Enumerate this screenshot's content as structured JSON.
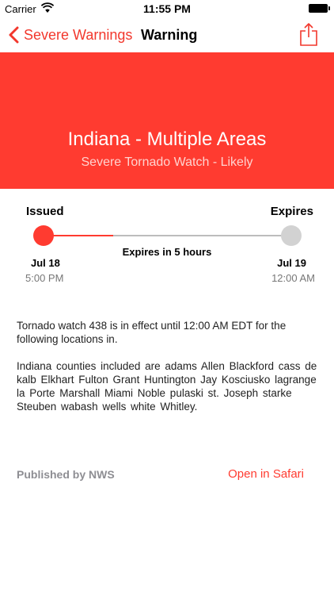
{
  "status_bar": {
    "carrier": "Carrier",
    "time": "11:55 PM"
  },
  "nav": {
    "back_label": "Severe Warnings",
    "title": "Warning"
  },
  "alert": {
    "title": "Indiana - Multiple Areas",
    "subtitle": "Severe Tornado Watch - Likely"
  },
  "timeline": {
    "issued_label": "Issued",
    "expires_label": "Expires",
    "remaining": "Expires in 5 hours",
    "progress": 0.28,
    "issued_date": "Jul 18",
    "issued_time": "5:00 PM",
    "expires_date": "Jul 19",
    "expires_time": "12:00 AM"
  },
  "description": {
    "paragraph1": "Tornado watch 438 is in effect until 12:00 AM EDT for the following locations in.",
    "paragraph2": "Indiana counties included are adams   Allen   Blackford cass   de kalb   Elkhart Fulton   Grant   Huntington Jay Kosciusko   lagrange la Porte   Marshall   Miami Noble pulaski   st. Joseph starke   Steuben   wabash wells white   Whitley."
  },
  "footer": {
    "published": "Published by NWS",
    "open_link": "Open in Safari"
  },
  "colors": {
    "accent": "#ff3b30",
    "track": "#bdbdbd",
    "end_dot": "#d2d2d2"
  },
  "icons": {
    "back": "chevron-left-icon",
    "share": "share-icon",
    "wifi": "wifi-icon",
    "battery": "battery-icon"
  }
}
